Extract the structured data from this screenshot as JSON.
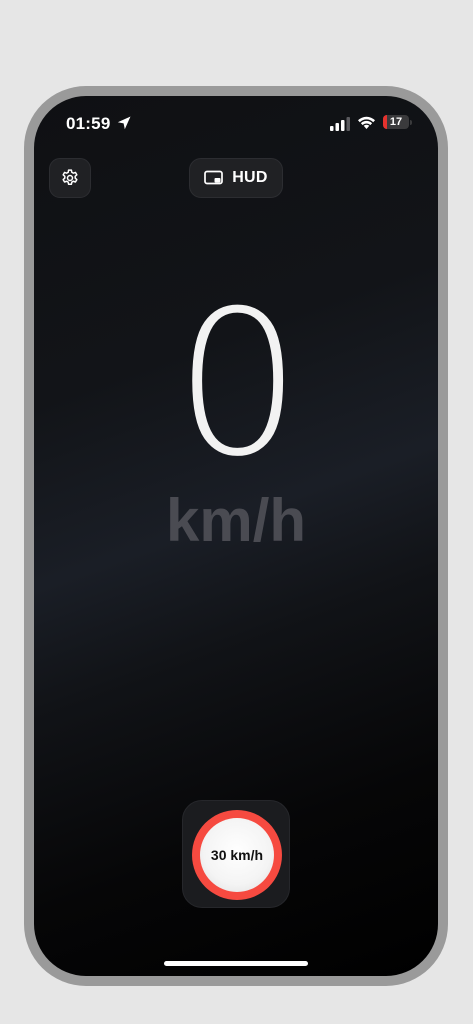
{
  "status_bar": {
    "time": "01:59",
    "battery_level": "17",
    "icons": {
      "location": "location-arrow-icon",
      "signal": "cellular-signal-icon",
      "wifi": "wifi-icon",
      "battery": "battery-icon"
    }
  },
  "toolbar": {
    "settings_icon": "gear-icon",
    "hud_icon": "hud-display-icon",
    "hud_label": "HUD"
  },
  "speedometer": {
    "speed": "0",
    "unit": "km/h"
  },
  "speed_limit": {
    "label": "30 km/h",
    "ring_color": "#f64a40"
  },
  "colors": {
    "background": "#0f1013",
    "speed_text": "#f2f2f2",
    "unit_text": "#4a4b52",
    "button_bg": "#202124",
    "battery_low": "#e5322e"
  }
}
